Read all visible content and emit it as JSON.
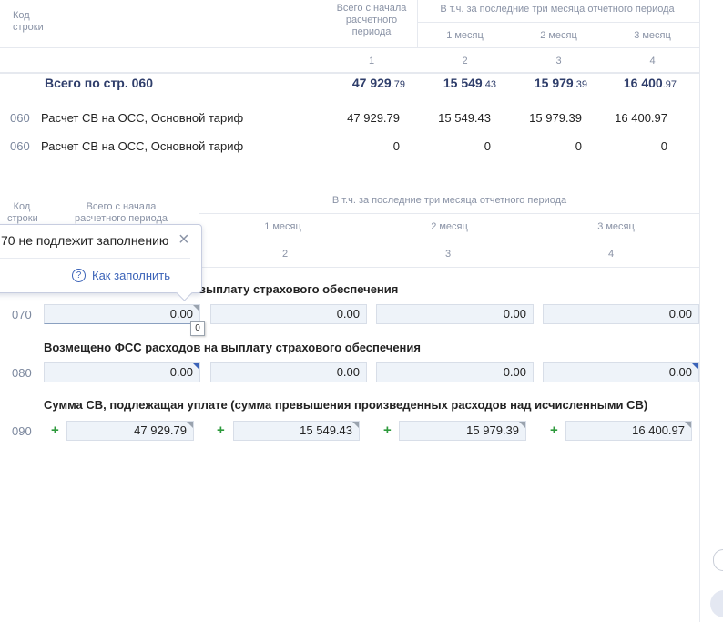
{
  "table1": {
    "header": {
      "code_col": "Код\nстроки",
      "total_col": "Всего с начала\nрасчетного\nпериода",
      "last3_group": "В т.ч. за последние три месяца отчетного периода",
      "month1": "1 месяц",
      "month2": "2 месяц",
      "month3": "3 месяц",
      "colnum1": "1",
      "colnum2": "2",
      "colnum3": "3",
      "colnum4": "4"
    },
    "total_row": {
      "label": "Всего по стр. 060",
      "v1_int": "47 929",
      "v1_dec": ".79",
      "v2_int": "15 549",
      "v2_dec": ".43",
      "v3_int": "15 979",
      "v3_dec": ".39",
      "v4_int": "16 400",
      "v4_dec": ".97"
    },
    "rows": [
      {
        "code": "060",
        "label": "Расчет СВ на ОСС, Основной тариф",
        "v1": "47 929.79",
        "v2": "15 549.43",
        "v3": "15 979.39",
        "v4": "16 400.97"
      },
      {
        "code": "060",
        "label": "Расчет СВ на ОСС, Основной тариф",
        "v1": "0",
        "v2": "0",
        "v3": "0",
        "v4": "0"
      }
    ]
  },
  "table2": {
    "header": {
      "code_col": "Код\nстроки",
      "total_col": "Всего с начала\nрасчетного периода",
      "last3_group": "В т.ч. за последние три месяца отчетного периода",
      "month1": "1 месяц",
      "month2": "2 месяц",
      "month3": "3 месяц",
      "colnum2": "2",
      "colnum3": "3",
      "colnum4": "4"
    },
    "section070": {
      "title_visible": "выплату страхового обеспечения",
      "code": "070",
      "v1": "0.00",
      "v2": "0.00",
      "v3": "0.00",
      "v4": "0.00"
    },
    "section080": {
      "title": "Возмещено ФСС расходов на выплату страхового обеспечения",
      "code": "080",
      "v1": "0.00",
      "v2": "0.00",
      "v3": "0.00",
      "v4": "0.00"
    },
    "section090": {
      "title": "Сумма СВ, подлежащая уплате (сумма превышения произведенных расходов над исчисленными СВ)",
      "code": "090",
      "plus": "+",
      "v1": "47 929.79",
      "v2": "15 549.43",
      "v3": "15 979.39",
      "v4": "16 400.97"
    }
  },
  "popover": {
    "message": "70 не подлежит заполнению",
    "close_icon": "×",
    "help_icon": "?",
    "help_link": "Как заполнить"
  },
  "field_tooltip": "0",
  "colors": {
    "header_text": "#8a93a6",
    "total_text": "#2f3e6b",
    "field_bg": "#eef3f9",
    "plus": "#2e9a3c",
    "link": "#3b63b8"
  }
}
